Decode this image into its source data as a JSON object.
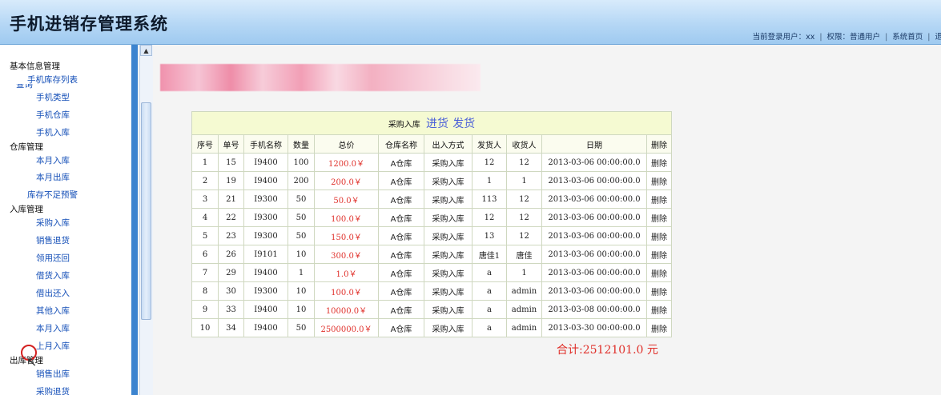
{
  "app": {
    "title": "手机进销存管理系统"
  },
  "topbar": {
    "user": "当前登录用户：xx",
    "role": "权限：普通用户",
    "home": "系统首页",
    "extra": "退"
  },
  "sidebar": {
    "cut_item": "查询",
    "groups": [
      {
        "label": "基本信息管理",
        "items": [
          "手机库存列表",
          "手机类型",
          "手机仓库",
          "手机入库"
        ]
      },
      {
        "label": "仓库管理",
        "items": [
          "本月入库",
          "本月出库",
          "库存不足预警"
        ]
      },
      {
        "label": "入库管理",
        "items": [
          "采购入库",
          "销售退货",
          "领用还回",
          "借货入库",
          "借出还入",
          "其他入库",
          "本月入库",
          "上月入库"
        ]
      },
      {
        "label": "出库管理",
        "items": [
          "销售出库",
          "采购退货"
        ]
      }
    ]
  },
  "table": {
    "title_label": "采购入库",
    "link_in": "进货",
    "link_out": "发货",
    "headers": [
      "序号",
      "单号",
      "手机名称",
      "数量",
      "总价",
      "仓库名称",
      "出入方式",
      "发货人",
      "收货人",
      "日期",
      "删除"
    ],
    "rows": [
      [
        "1",
        "15",
        "I9400",
        "100",
        "1200.0￥",
        "A仓库",
        "采购入库",
        "12",
        "12",
        "2013-03-06 00:00:00.0",
        "删除"
      ],
      [
        "2",
        "19",
        "I9400",
        "200",
        "200.0￥",
        "A仓库",
        "采购入库",
        "1",
        "1",
        "2013-03-06 00:00:00.0",
        "删除"
      ],
      [
        "3",
        "21",
        "I9300",
        "50",
        "50.0￥",
        "A仓库",
        "采购入库",
        "113",
        "12",
        "2013-03-06 00:00:00.0",
        "删除"
      ],
      [
        "4",
        "22",
        "I9300",
        "50",
        "100.0￥",
        "A仓库",
        "采购入库",
        "12",
        "12",
        "2013-03-06 00:00:00.0",
        "删除"
      ],
      [
        "5",
        "23",
        "I9300",
        "50",
        "150.0￥",
        "A仓库",
        "采购入库",
        "13",
        "12",
        "2013-03-06 00:00:00.0",
        "删除"
      ],
      [
        "6",
        "26",
        "I9101",
        "10",
        "300.0￥",
        "A仓库",
        "采购入库",
        "唐佳1",
        "唐佳",
        "2013-03-06 00:00:00.0",
        "删除"
      ],
      [
        "7",
        "29",
        "I9400",
        "1",
        "1.0￥",
        "A仓库",
        "采购入库",
        "a",
        "1",
        "2013-03-06 00:00:00.0",
        "删除"
      ],
      [
        "8",
        "30",
        "I9300",
        "10",
        "100.0￥",
        "A仓库",
        "采购入库",
        "a",
        "admin",
        "2013-03-06 00:00:00.0",
        "删除"
      ],
      [
        "9",
        "33",
        "I9400",
        "10",
        "10000.0￥",
        "A仓库",
        "采购入库",
        "a",
        "admin",
        "2013-03-08 00:00:00.0",
        "删除"
      ],
      [
        "10",
        "34",
        "I9400",
        "50",
        "2500000.0￥",
        "A仓库",
        "采购入库",
        "a",
        "admin",
        "2013-03-30 00:00:00.0",
        "删除"
      ]
    ],
    "grand_total": "合计:2512101.0 元"
  },
  "colors": {
    "header": "#b5d7f5",
    "divider": "#3c84cf",
    "total": "#e0302a",
    "link": "#1650b8"
  },
  "icons": {
    "scroll_up": "chevron-up-icon",
    "cursor": "pointer-cursor-icon"
  }
}
